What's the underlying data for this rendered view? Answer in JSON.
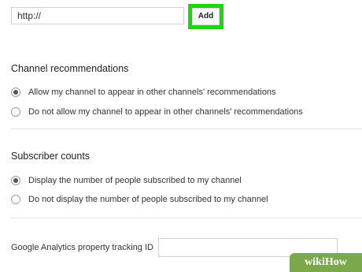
{
  "url_field": {
    "value": "http://"
  },
  "add_button": {
    "label": "Add"
  },
  "channel_recommendations": {
    "title": "Channel recommendations",
    "options": [
      {
        "label": "Allow my channel to appear in other channels' recommendations",
        "selected": true
      },
      {
        "label": "Do not allow my channel to appear in other channels' recommendations",
        "selected": false
      }
    ]
  },
  "subscriber_counts": {
    "title": "Subscriber counts",
    "options": [
      {
        "label": "Display the number of people subscribed to my channel",
        "selected": true
      },
      {
        "label": "Do not display the number of people subscribed to my channel",
        "selected": false
      }
    ]
  },
  "analytics": {
    "label": "Google Analytics property tracking ID",
    "value": ""
  },
  "watermark": {
    "text": "wikiHow"
  },
  "colors": {
    "highlight": "#1ed60e",
    "watermark_bg": "#7aa84a"
  }
}
